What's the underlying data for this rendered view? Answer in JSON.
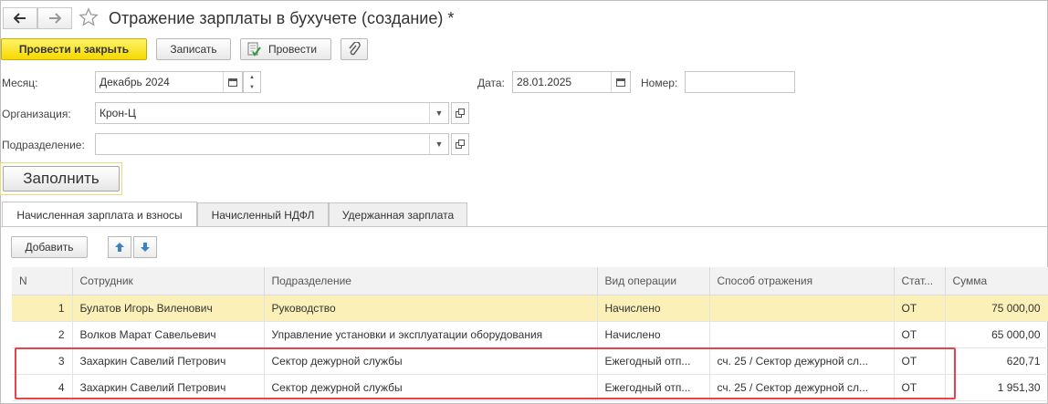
{
  "window": {
    "title": "Отражение зарплаты в бухучете (создание) *"
  },
  "toolbar": {
    "post_close_label": "Провести и закрыть",
    "save_label": "Записать",
    "post_label": "Провести"
  },
  "form": {
    "month_label": "Месяц:",
    "month_value": "Декабрь 2024",
    "date_label": "Дата:",
    "date_value": "28.01.2025",
    "number_label": "Номер:",
    "number_value": "",
    "org_label": "Организация:",
    "org_value": "Крон-Ц",
    "division_label": "Подразделение:",
    "division_value": ""
  },
  "fill_button_label": "Заполнить",
  "tabs": [
    {
      "label": "Начисленная зарплата и взносы",
      "active": true
    },
    {
      "label": "Начисленный НДФЛ",
      "active": false
    },
    {
      "label": "Удержанная зарплата",
      "active": false
    }
  ],
  "table_toolbar": {
    "add_label": "Добавить"
  },
  "table": {
    "columns": [
      "N",
      "Сотрудник",
      "Подразделение",
      "Вид операции",
      "Способ отражения",
      "Стат...",
      "Сумма"
    ],
    "rows": [
      {
        "n": "1",
        "employee": "Булатов Игорь Виленович",
        "division": "Руководство",
        "operation": "Начислено",
        "method": "",
        "stat": "ОТ",
        "sum": "75 000,00"
      },
      {
        "n": "2",
        "employee": "Волков Марат Савельевич",
        "division": "Управление установки и эксплуатации оборудования",
        "operation": "Начислено",
        "method": "",
        "stat": "ОТ",
        "sum": "65 000,00"
      },
      {
        "n": "3",
        "employee": "Захаркин Савелий Петрович",
        "division": "Сектор дежурной службы",
        "operation": "Ежегодный отп...",
        "method": "сч. 25 / Сектор дежурной сл...",
        "stat": "ОТ",
        "sum": "620,71"
      },
      {
        "n": "4",
        "employee": "Захаркин Савелий Петрович",
        "division": "Сектор дежурной службы",
        "operation": "Ежегодный отп...",
        "method": "сч. 25 / Сектор дежурной сл...",
        "stat": "ОТ",
        "sum": "1 951,30"
      }
    ]
  },
  "colors": {
    "primary_button": "#f5d900",
    "selected_row": "#fbf0b8",
    "highlight_box": "#e8424b"
  }
}
